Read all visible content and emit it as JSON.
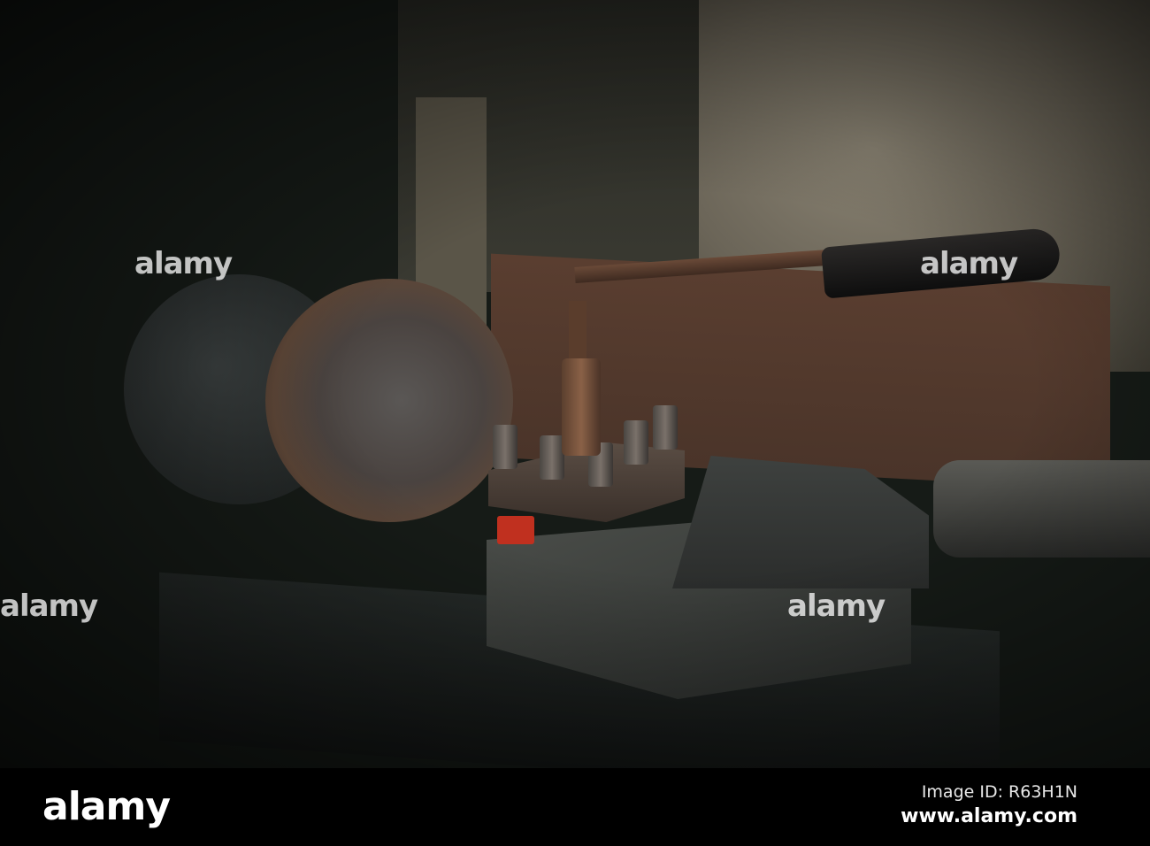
{
  "image": {
    "description_alt": "Old metal lathe with chuck, tool post and handle",
    "watermark_text": "alamy"
  },
  "footer": {
    "logo": "alamy",
    "image_id": "Image ID: R63H1N",
    "website": "www.alamy.com"
  },
  "colors": {
    "background": "#161b17",
    "wall": "#7a7466",
    "board": "#5a3e30",
    "tool_red": "#c0301f",
    "bar": "#000000"
  }
}
